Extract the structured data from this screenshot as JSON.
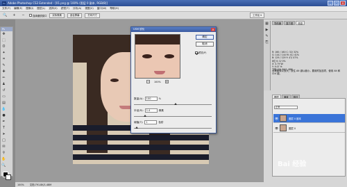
{
  "titlebar": {
    "logo": "Ps",
    "title": "Adobe Photoshop CS3 Extended - [01.png @ 100% (图层 0 副本, RGB/8)]",
    "buttons": [
      "_",
      "□",
      "×"
    ]
  },
  "menubar": {
    "items": [
      "文件(F)",
      "编辑(E)",
      "图像(I)",
      "图层(L)",
      "选择(S)",
      "滤镜(T)",
      "分析(A)",
      "视图(V)",
      "窗口(W)",
      "帮助(H)"
    ]
  },
  "options": {
    "checkbox_label": "连续缩放窗口",
    "btn1": "实际像素",
    "btn2": "适合屏幕",
    "btn3": "打印尺寸",
    "workspace": "工作区 ▾"
  },
  "toolbox": {
    "header": "Ps"
  },
  "status": {
    "zoom": "100%",
    "doc": "文档:791.8K/1.48M"
  },
  "dialog": {
    "title": "USM 锐化",
    "ok": "确定",
    "cancel": "取消",
    "preview_label": "预览(P)",
    "zoom_value": "100%",
    "amount_label": "数量(A):",
    "amount_value": "100",
    "amount_unit": "%",
    "radius_label": "半径(R):",
    "radius_value": "1.4",
    "radius_unit": "像素",
    "threshold_label": "阈值(T):",
    "threshold_value": "1",
    "threshold_unit": "色阶"
  },
  "rpanel": {
    "tabs_top": [
      "导航器",
      "直方图",
      "信息"
    ],
    "info_lines": [
      "R:    160 / 160   C:    32/ 32%",
      "G:    144 / 144   M:    41/ 41%",
      "B:    129 / 129   Y:    47/ 47%",
      "8位               K:     0/  0%",
      "X:     4.79        W:",
      "Y:     9.07        H:",
      "文档:791.8K/1.48M"
    ],
    "note": "点按图像以放大；按住 Alt 键以缩小。要用附加选项，使用 Alt 和 Ctrl 键。",
    "layers_tabs": [
      "图层",
      "通道",
      "路径"
    ],
    "blend": "正常",
    "layers": [
      "图层 0 副本",
      "图层 0"
    ]
  },
  "watermark": "Bai 经验"
}
